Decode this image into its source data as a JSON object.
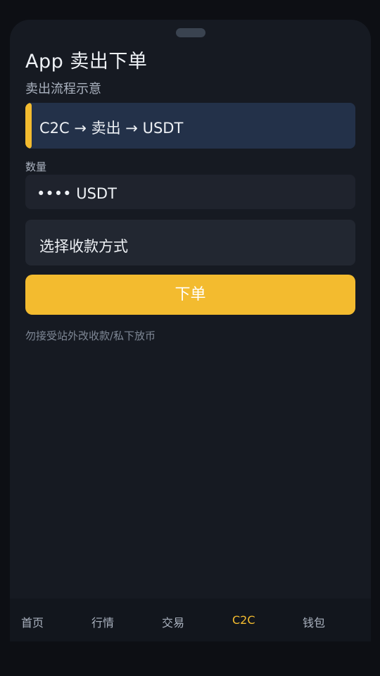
{
  "page": {
    "title": "App 卖出下单",
    "subtitle": "卖出流程示意"
  },
  "flow": {
    "text": "C2C → 卖出 → USDT"
  },
  "quantity": {
    "label": "数量",
    "value": "•••• USDT"
  },
  "payment": {
    "placeholder": "选择收款方式"
  },
  "order_button": {
    "label": "下单"
  },
  "warning": {
    "text": "勿接受站外改收款/私下放币"
  },
  "tabbar": {
    "items": [
      {
        "label": "首页",
        "active": false
      },
      {
        "label": "行情",
        "active": false
      },
      {
        "label": "交易",
        "active": false
      },
      {
        "label": "C2C",
        "active": true
      },
      {
        "label": "钱包",
        "active": false
      }
    ]
  },
  "colors": {
    "accent": "#f3bb2f",
    "background": "#161a22",
    "flow_box": "#233149"
  }
}
